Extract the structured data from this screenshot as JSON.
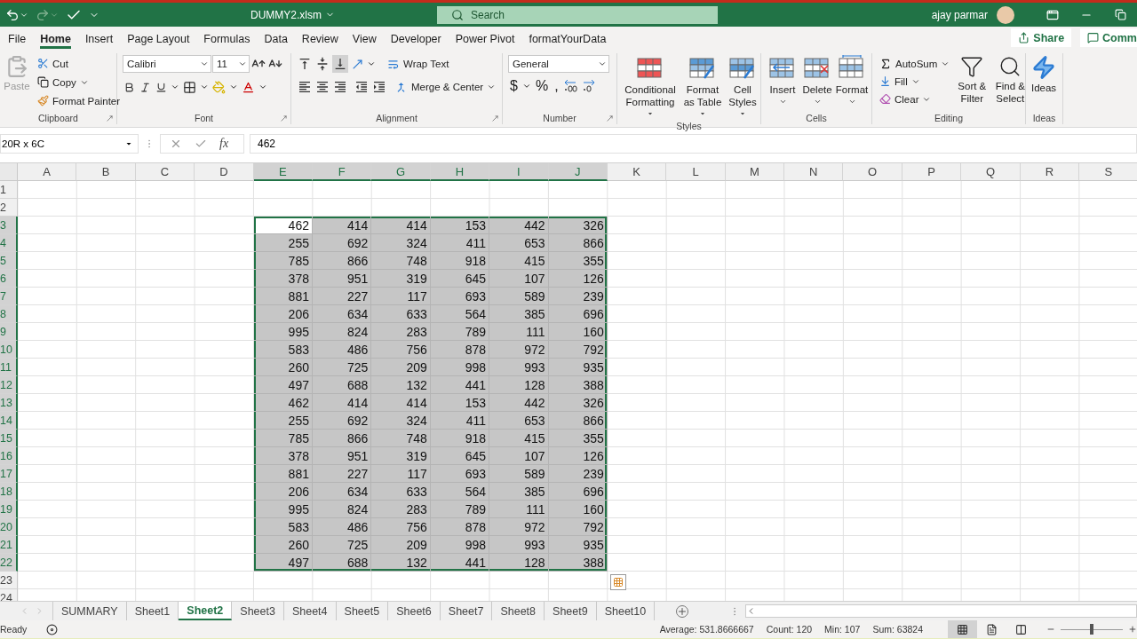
{
  "title_bar": {
    "file_name": "DUMMY2.xlsm",
    "search": {
      "placeholder": "Search"
    },
    "user": "ajay parmar",
    "redo_disabled": true
  },
  "ribbon_tabs": [
    {
      "label": "File",
      "selected": false
    },
    {
      "label": "Home",
      "selected": true
    },
    {
      "label": "Insert",
      "selected": false
    },
    {
      "label": "Page Layout",
      "selected": false
    },
    {
      "label": "Formulas",
      "selected": false
    },
    {
      "label": "Data",
      "selected": false
    },
    {
      "label": "Review",
      "selected": false
    },
    {
      "label": "View",
      "selected": false
    },
    {
      "label": "Developer",
      "selected": false
    },
    {
      "label": "Power Pivot",
      "selected": false
    },
    {
      "label": "formatYourData",
      "selected": false
    }
  ],
  "share": "Share",
  "comments": "Comm",
  "ribbon_groups": [
    {
      "kind": "clipboard",
      "label": "Clipboard",
      "launcher": true,
      "paste": "Paste",
      "paste_disabled": true,
      "cut": "Cut",
      "copy": "Copy",
      "format_painter": "Format Painter"
    },
    {
      "kind": "font",
      "label": "Font",
      "launcher": true,
      "font_name": "Calibri",
      "font_size": "11"
    },
    {
      "kind": "alignment",
      "label": "Alignment",
      "launcher": true,
      "wrap": "Wrap Text",
      "merge": "Merge & Center",
      "bottom_align_selected": true
    },
    {
      "kind": "number",
      "label": "Number",
      "launcher": true,
      "format": "General",
      "currency": "$",
      "percent": "%",
      "comma": ","
    },
    {
      "kind": "styles",
      "label": "Styles",
      "launcher": false,
      "buttons": [
        "Conditional Formatting",
        "Format as Table",
        "Cell Styles"
      ]
    },
    {
      "kind": "cells",
      "label": "Cells",
      "launcher": false,
      "buttons": [
        "Insert",
        "Delete",
        "Format"
      ]
    },
    {
      "kind": "editing",
      "label": "Editing",
      "launcher": false,
      "autosum": "AutoSum",
      "fill": "Fill",
      "clear": "Clear",
      "sort": "Sort & Filter",
      "find": "Find & Select"
    },
    {
      "kind": "ideas",
      "label": "Ideas",
      "launcher": false,
      "ideas": "Ideas"
    }
  ],
  "formula_bar": {
    "name_box": "20R x 6C",
    "function_label": "fx",
    "formula": "462"
  },
  "columns": [
    {
      "label": "A",
      "selected": false
    },
    {
      "label": "B",
      "selected": false
    },
    {
      "label": "C",
      "selected": false
    },
    {
      "label": "D",
      "selected": false
    },
    {
      "label": "E",
      "selected": true
    },
    {
      "label": "F",
      "selected": true
    },
    {
      "label": "G",
      "selected": true
    },
    {
      "label": "H",
      "selected": true
    },
    {
      "label": "I",
      "selected": true
    },
    {
      "label": "J",
      "selected": true
    },
    {
      "label": "K",
      "selected": false
    },
    {
      "label": "L",
      "selected": false
    },
    {
      "label": "M",
      "selected": false
    },
    {
      "label": "N",
      "selected": false
    },
    {
      "label": "O",
      "selected": false
    },
    {
      "label": "P",
      "selected": false
    },
    {
      "label": "Q",
      "selected": false
    },
    {
      "label": "R",
      "selected": false
    },
    {
      "label": "S",
      "selected": false
    }
  ],
  "rows": [
    {
      "label": "1",
      "selected": false,
      "active": false,
      "values": []
    },
    {
      "label": "2",
      "selected": false,
      "active": false,
      "values": []
    },
    {
      "label": "3",
      "selected": true,
      "active": true,
      "values": [
        "462",
        "414",
        "414",
        "153",
        "442",
        "326"
      ]
    },
    {
      "label": "4",
      "selected": true,
      "active": false,
      "values": [
        "255",
        "692",
        "324",
        "411",
        "653",
        "866"
      ]
    },
    {
      "label": "5",
      "selected": true,
      "active": false,
      "values": [
        "785",
        "866",
        "748",
        "918",
        "415",
        "355"
      ]
    },
    {
      "label": "6",
      "selected": true,
      "active": false,
      "values": [
        "378",
        "951",
        "319",
        "645",
        "107",
        "126"
      ]
    },
    {
      "label": "7",
      "selected": true,
      "active": false,
      "values": [
        "881",
        "227",
        "117",
        "693",
        "589",
        "239"
      ]
    },
    {
      "label": "8",
      "selected": true,
      "active": false,
      "values": [
        "206",
        "634",
        "633",
        "564",
        "385",
        "696"
      ]
    },
    {
      "label": "9",
      "selected": true,
      "active": false,
      "values": [
        "995",
        "824",
        "283",
        "789",
        "111",
        "160"
      ]
    },
    {
      "label": "10",
      "selected": true,
      "active": false,
      "values": [
        "583",
        "486",
        "756",
        "878",
        "972",
        "792"
      ]
    },
    {
      "label": "11",
      "selected": true,
      "active": false,
      "values": [
        "260",
        "725",
        "209",
        "998",
        "993",
        "935"
      ]
    },
    {
      "label": "12",
      "selected": true,
      "active": false,
      "values": [
        "497",
        "688",
        "132",
        "441",
        "128",
        "388"
      ]
    },
    {
      "label": "13",
      "selected": true,
      "active": false,
      "values": [
        "462",
        "414",
        "414",
        "153",
        "442",
        "326"
      ]
    },
    {
      "label": "14",
      "selected": true,
      "active": false,
      "values": [
        "255",
        "692",
        "324",
        "411",
        "653",
        "866"
      ]
    },
    {
      "label": "15",
      "selected": true,
      "active": false,
      "values": [
        "785",
        "866",
        "748",
        "918",
        "415",
        "355"
      ]
    },
    {
      "label": "16",
      "selected": true,
      "active": false,
      "values": [
        "378",
        "951",
        "319",
        "645",
        "107",
        "126"
      ]
    },
    {
      "label": "17",
      "selected": true,
      "active": false,
      "values": [
        "881",
        "227",
        "117",
        "693",
        "589",
        "239"
      ]
    },
    {
      "label": "18",
      "selected": true,
      "active": false,
      "values": [
        "206",
        "634",
        "633",
        "564",
        "385",
        "696"
      ]
    },
    {
      "label": "19",
      "selected": true,
      "active": false,
      "values": [
        "995",
        "824",
        "283",
        "789",
        "111",
        "160"
      ]
    },
    {
      "label": "20",
      "selected": true,
      "active": false,
      "values": [
        "583",
        "486",
        "756",
        "878",
        "972",
        "792"
      ]
    },
    {
      "label": "21",
      "selected": true,
      "active": false,
      "values": [
        "260",
        "725",
        "209",
        "998",
        "993",
        "935"
      ]
    },
    {
      "label": "22",
      "selected": true,
      "active": false,
      "values": [
        "497",
        "688",
        "132",
        "441",
        "128",
        "388"
      ]
    },
    {
      "label": "23",
      "selected": false,
      "active": false,
      "values": []
    },
    {
      "label": "24",
      "selected": false,
      "active": false,
      "values": []
    }
  ],
  "sheet_tabs": [
    {
      "label": "SUMMARY",
      "selected": false
    },
    {
      "label": "Sheet1",
      "selected": false
    },
    {
      "label": "Sheet2",
      "selected": true
    },
    {
      "label": "Sheet3",
      "selected": false
    },
    {
      "label": "Sheet4",
      "selected": false
    },
    {
      "label": "Sheet5",
      "selected": false
    },
    {
      "label": "Sheet6",
      "selected": false
    },
    {
      "label": "Sheet7",
      "selected": false
    },
    {
      "label": "Sheet8",
      "selected": false
    },
    {
      "label": "Sheet9",
      "selected": false
    },
    {
      "label": "Sheet10",
      "selected": false
    }
  ],
  "status_bar": {
    "status": "Ready",
    "stats": [
      "Average: 531.8666667",
      "Count: 120",
      "Min: 107",
      "Sum: 63824"
    ],
    "views": [
      {
        "kind": "normal",
        "selected": true
      },
      {
        "kind": "page_layout",
        "selected": false
      },
      {
        "kind": "page_break",
        "selected": false
      }
    ],
    "zoom": {
      "level": 0.5
    }
  }
}
